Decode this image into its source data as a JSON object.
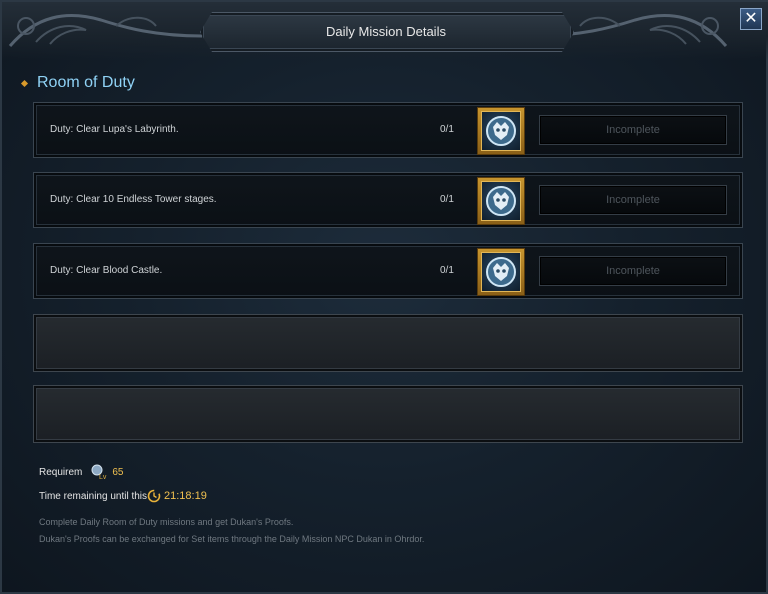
{
  "window": {
    "title": "Daily Mission Details",
    "close_label": "✕"
  },
  "section": {
    "title": "Room of Duty"
  },
  "missions": [
    {
      "text": "Duty: Clear Lupa's Labyrinth.",
      "count": "0/1",
      "status": "Incomplete"
    },
    {
      "text": "Duty: Clear 10 Endless Tower stages.",
      "count": "0/1",
      "status": "Incomplete"
    },
    {
      "text": "Duty: Clear Blood Castle.",
      "count": "0/1",
      "status": "Incomplete"
    }
  ],
  "requirement": {
    "label": "Requirem",
    "level_icon": "level-icon",
    "level": "65"
  },
  "timer": {
    "label": "Time remaining until this",
    "icon": "clock-icon",
    "value": "21:18:19"
  },
  "description": {
    "line1": "Complete Daily Room of Duty missions and get Dukan's Proofs.",
    "line2": "Dukan's Proofs can be exchanged for Set items through the Daily Mission NPC Dukan in Ohrdor."
  },
  "colors": {
    "section_title": "#8fd2f5",
    "highlight_value": "#f0c050",
    "reward_frame": "#c7952e"
  }
}
